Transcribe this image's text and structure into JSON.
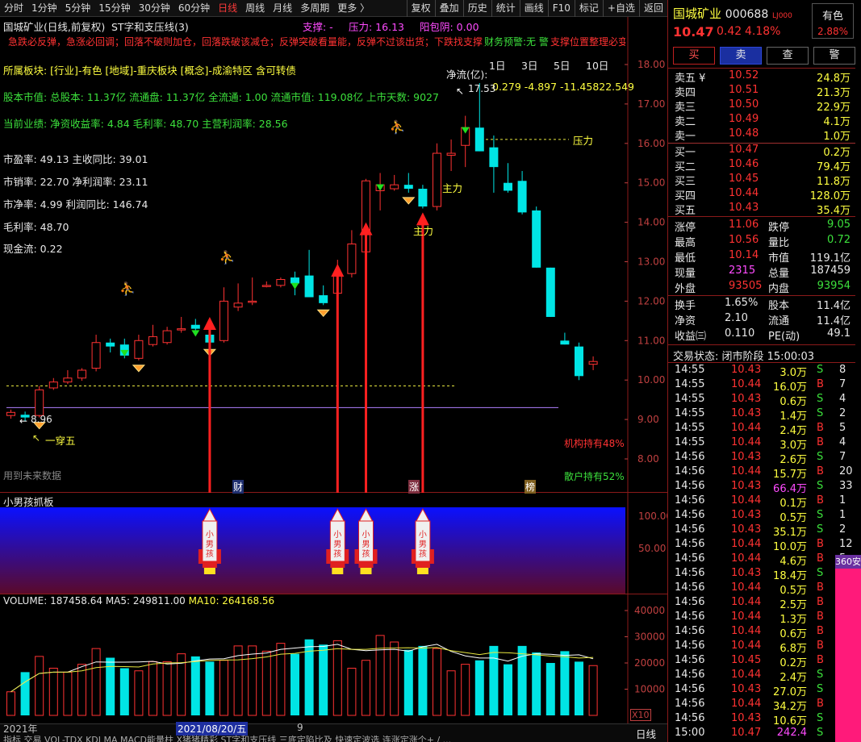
{
  "toolbar": {
    "left": [
      "分时",
      "1分钟",
      "5分钟",
      "15分钟",
      "30分钟",
      "60分钟",
      "日线",
      "周线",
      "月线",
      "多周期",
      "更多 〉"
    ],
    "active": "日线",
    "right": [
      "复权",
      "叠加",
      "历史",
      "统计",
      "画线",
      "F10",
      "标记",
      "+自选",
      "返回"
    ]
  },
  "chart": {
    "title": "国城矿业(日线,前复权)",
    "indicator_name": "ST字和支压线(3)",
    "support_label": "支撑: -",
    "pressure_label": "压力: 16.13",
    "yang_label": "阳包阴: 0.00",
    "warning": "急跌必反弹，急涨必回调；回落不破则加仓，回落跌破该减仓；反弹突破看量能，反弹不过该出货；下跌找支撑，上涨看压力，支撑位置整理必变",
    "finance_warning": "财务预警:无 警",
    "sector": "所属板块: [行业]-有色 [地域]-重庆板块 [概念]-成渝特区 含可转债",
    "equity": "股本市值: 总股本: 11.37亿 流通盘: 11.37亿 全流通: 1.00 流通市值: 119.08亿 上市天数: 9027",
    "performance": "当前业绩:  净资收益率: 4.84  毛利率: 48.70  主营利润率: 28.56",
    "metrics": [
      "市盈率: 49.13  主收同比: 39.01",
      "市销率: 22.70 净利润率: 23.11",
      "市净率:  4.99  利润同比: 146.74",
      "毛利率: 48.70",
      "现金流: 0.22"
    ],
    "netflow_label": "净流(亿):",
    "netflow_values": "0.279  -4.897  -11.45822.549",
    "period_tabs": [
      "1日",
      "3日",
      "5日",
      "10日"
    ],
    "high_label": "17.53",
    "low_label": "8.96",
    "cross_label": "一穿五",
    "main_force": "主力",
    "pressure_text": "压力",
    "inst_hold": "机构持有48%",
    "retail_hold": "散户持有52%",
    "future_data": "用到未来数据",
    "markers": [
      "财",
      "涨",
      "榜"
    ],
    "y_ticks": [
      "18.00",
      "17.00",
      "16.00",
      "15.00",
      "14.00",
      "13.00",
      "12.00",
      "11.00",
      "10.00",
      "9.00",
      "8.00"
    ]
  },
  "chart_data": {
    "type": "candlestick",
    "y_unit": "price",
    "ohlc": [
      [
        9.1,
        9.25,
        9.02,
        9.18
      ],
      [
        9.12,
        9.2,
        8.96,
        9.05
      ],
      [
        9.1,
        9.85,
        9.05,
        9.75
      ],
      [
        9.8,
        10.05,
        9.75,
        9.95
      ],
      [
        9.95,
        10.25,
        9.9,
        10.05
      ],
      [
        10.05,
        10.3,
        9.98,
        10.25
      ],
      [
        10.3,
        11.15,
        10.22,
        10.95
      ],
      [
        10.95,
        11.05,
        10.7,
        10.85
      ],
      [
        10.9,
        11.05,
        10.55,
        10.62
      ],
      [
        10.55,
        11.15,
        10.5,
        11.0
      ],
      [
        10.9,
        11.4,
        10.85,
        11.1
      ],
      [
        10.95,
        11.35,
        10.9,
        11.25
      ],
      [
        11.3,
        11.6,
        11.2,
        11.3
      ],
      [
        11.4,
        11.55,
        11.2,
        11.3
      ],
      [
        11.15,
        11.5,
        10.9,
        10.95
      ],
      [
        11.0,
        12.35,
        10.95,
        12.0
      ],
      [
        11.85,
        12.45,
        11.75,
        11.95
      ],
      [
        12.0,
        12.6,
        11.9,
        12.0
      ],
      [
        12.4,
        12.5,
        12.35,
        12.4
      ],
      [
        12.4,
        12.6,
        12.35,
        12.55
      ],
      [
        12.6,
        12.75,
        12.15,
        12.45
      ],
      [
        12.65,
        13.3,
        12.2,
        12.1
      ],
      [
        12.15,
        12.4,
        11.9,
        11.95
      ],
      [
        12.2,
        13.05,
        11.95,
        12.65
      ],
      [
        12.7,
        13.8,
        12.6,
        13.45
      ],
      [
        13.25,
        15.1,
        13.2,
        15.05
      ],
      [
        14.8,
        15.25,
        14.3,
        14.95
      ],
      [
        14.85,
        15.2,
        14.8,
        14.95
      ],
      [
        14.95,
        15.25,
        14.75,
        14.85
      ],
      [
        14.85,
        14.95,
        14.35,
        14.4
      ],
      [
        14.4,
        16.0,
        14.3,
        15.75
      ],
      [
        15.7,
        16.1,
        15.3,
        15.75
      ],
      [
        15.95,
        16.7,
        15.4,
        16.4
      ],
      [
        16.4,
        17.53,
        15.8,
        15.8
      ],
      [
        15.9,
        16.2,
        14.75,
        15.4
      ],
      [
        15.0,
        15.5,
        14.75,
        14.8
      ],
      [
        15.05,
        15.3,
        14.2,
        14.25
      ],
      [
        14.3,
        14.4,
        12.85,
        12.85
      ],
      [
        12.85,
        12.85,
        11.6,
        11.6
      ],
      [
        11.0,
        11.2,
        10.9,
        10.9
      ],
      [
        10.85,
        10.95,
        10.0,
        10.1
      ],
      [
        10.4,
        10.6,
        10.25,
        10.47
      ]
    ],
    "volume_ticks": [
      "40000",
      "30000",
      "20000",
      "10000"
    ],
    "volume_label": "VOLUME: 187458.64",
    "ma5_label": "MA5: 249811.00",
    "ma10_label": "MA10: 264168.56",
    "volumes": [
      90,
      165,
      225,
      180,
      165,
      195,
      255,
      220,
      180,
      170,
      205,
      205,
      235,
      225,
      205,
      210,
      265,
      265,
      245,
      275,
      235,
      290,
      270,
      285,
      180,
      210,
      305,
      280,
      250,
      265,
      255,
      170,
      195,
      210,
      265,
      195,
      265,
      240,
      200,
      245,
      205,
      190
    ]
  },
  "ind2": {
    "title": "小男孩抓板",
    "ticks": [
      "100.00",
      "50.00"
    ],
    "rocket_text": "小男孩"
  },
  "volume_axis_unit": "X10",
  "bottom": {
    "year": "2021年",
    "date_label": "2021/08/20/五",
    "month_marker": "9",
    "tabs": "指标  交易  VOL-TDX  KDJ  MA  MACD能量柱  X猪猪精彩  ST字和支压线  三底定陷比及  快速定波选  连涨定涨个+ / ...",
    "period": "日线"
  },
  "quote": {
    "name": "国城矿业",
    "code": "000688",
    "tag": "LJ000",
    "price": "10.47",
    "change": "0.42",
    "change_pct": "4.18%",
    "badge": "有色",
    "badge_pct": "2.88%",
    "buttons": [
      "买",
      "卖",
      "查",
      "警"
    ],
    "asks": [
      [
        "卖五 ¥",
        "10.52",
        "24.8万"
      ],
      [
        "卖四",
        "10.51",
        "21.3万"
      ],
      [
        "卖三",
        "10.50",
        "22.9万"
      ],
      [
        "卖二",
        "10.49",
        "4.1万"
      ],
      [
        "卖一",
        "10.48",
        "1.0万"
      ]
    ],
    "bids": [
      [
        "买一",
        "10.47",
        "0.2万"
      ],
      [
        "买二",
        "10.46",
        "79.4万"
      ],
      [
        "买三",
        "10.45",
        "11.8万"
      ],
      [
        "买四",
        "10.44",
        "128.0万"
      ],
      [
        "买五",
        "10.43",
        "35.4万"
      ]
    ],
    "stats": [
      [
        "涨停",
        "11.06",
        "跌停",
        "9.05"
      ],
      [
        "最高",
        "10.56",
        "量比",
        "0.72"
      ],
      [
        "最低",
        "10.14",
        "市值",
        "119.1亿"
      ],
      [
        "现量",
        "2315",
        "总量",
        "187459"
      ],
      [
        "外盘",
        "93505",
        "内盘",
        "93954"
      ]
    ],
    "stats2": [
      [
        "换手",
        "1.65%",
        "股本",
        "11.4亿"
      ],
      [
        "净资",
        "2.10",
        "流通",
        "11.4亿"
      ],
      [
        "收益㈢",
        "0.110",
        "PE(动)",
        "49.1"
      ]
    ],
    "status": "交易状态: 闭市阶段 15:00:03",
    "ticks": [
      [
        "14:55",
        "10.43",
        "3.0万",
        "S",
        "8"
      ],
      [
        "14:55",
        "10.44",
        "16.0万",
        "B",
        "7"
      ],
      [
        "14:55",
        "10.43",
        "0.6万",
        "S",
        "4"
      ],
      [
        "14:55",
        "10.43",
        "1.4万",
        "S",
        "2"
      ],
      [
        "14:55",
        "10.44",
        "2.4万",
        "B",
        "5"
      ],
      [
        "14:55",
        "10.44",
        "3.0万",
        "B",
        "4"
      ],
      [
        "14:56",
        "10.43",
        "2.6万",
        "S",
        "7"
      ],
      [
        "14:56",
        "10.44",
        "15.7万",
        "B",
        "20"
      ],
      [
        "14:56",
        "10.43",
        "66.4万",
        "S",
        "33"
      ],
      [
        "14:56",
        "10.44",
        "0.1万",
        "B",
        "1"
      ],
      [
        "14:56",
        "10.43",
        "0.5万",
        "S",
        "1"
      ],
      [
        "14:56",
        "10.43",
        "35.1万",
        "S",
        "2"
      ],
      [
        "14:56",
        "10.44",
        "10.0万",
        "B",
        "12"
      ],
      [
        "14:56",
        "10.44",
        "4.6万",
        "B",
        "5"
      ],
      [
        "14:56",
        "10.43",
        "18.4万",
        "S",
        "5"
      ],
      [
        "14:56",
        "10.44",
        "0.5万",
        "B",
        "1"
      ],
      [
        "14:56",
        "10.44",
        "2.5万",
        "B",
        "4"
      ],
      [
        "14:56",
        "10.44",
        "1.3万",
        "B",
        "2"
      ],
      [
        "14:56",
        "10.44",
        "0.6万",
        "B",
        "3"
      ],
      [
        "14:56",
        "10.44",
        "6.8万",
        "B",
        "5"
      ],
      [
        "14:56",
        "10.45",
        "0.2万",
        "B",
        "2"
      ],
      [
        "14:56",
        "10.44",
        "2.4万",
        "S",
        "3"
      ],
      [
        "14:56",
        "10.43",
        "27.0万",
        "S",
        "9"
      ],
      [
        "14:56",
        "10.44",
        "34.2万",
        "B",
        "31"
      ],
      [
        "14:56",
        "10.43",
        "10.6万",
        "S",
        "5"
      ],
      [
        "15:00",
        "10.47",
        "242.4万",
        "S",
        "5"
      ]
    ],
    "side_tag": "360安"
  },
  "colors": {
    "up": "#ff3232",
    "down": "#00e5e5",
    "ma5": "#ffffff",
    "ma10": "#e8e840",
    "grid": "#8b1a1a"
  }
}
